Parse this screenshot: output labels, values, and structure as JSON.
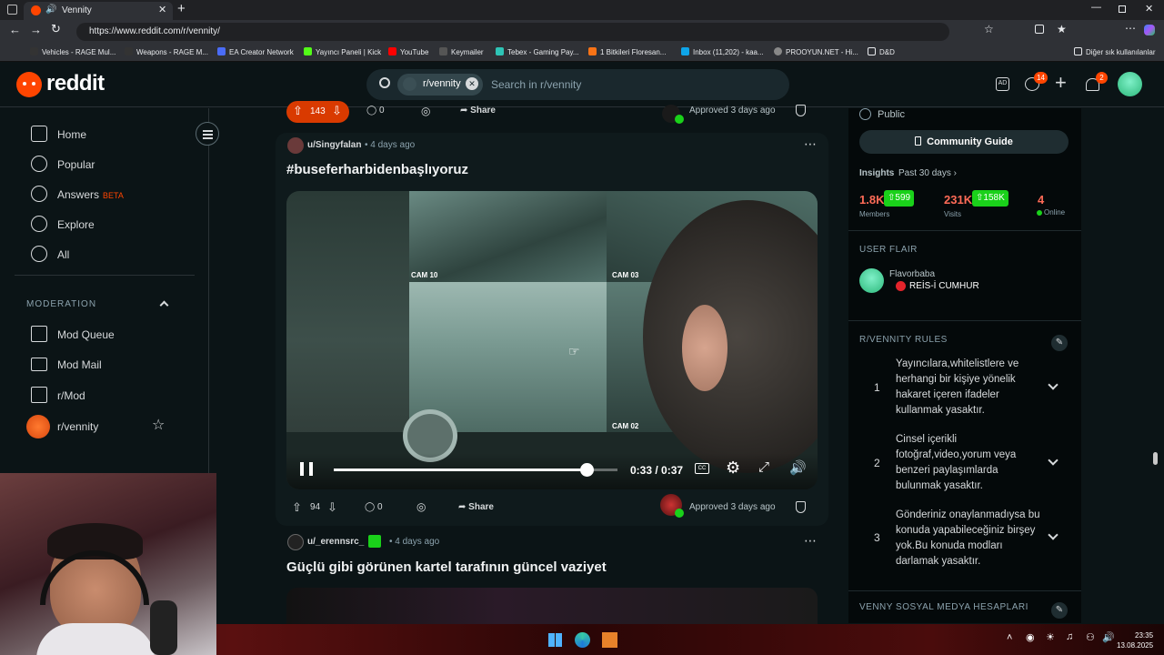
{
  "browser": {
    "tab_title": "Vennity",
    "url": "https://www.reddit.com/r/vennity/",
    "bookmarks": [
      "Vehicles - RAGE Mul...",
      "Weapons - RAGE M...",
      "EA Creator Network",
      "Yayıncı Paneli | Kick",
      "YouTube",
      "Keymailer",
      "Tebex - Gaming Pay...",
      "1 Bitkileri Floresan...",
      "Inbox (11,202) - kaa...",
      "PROOYUN.NET - Hi...",
      "D&D"
    ],
    "other_bookmarks": "Diğer sık kullanılanlar"
  },
  "header": {
    "logo": "reddit",
    "search_chip": "r/vennity",
    "search_placeholder": "Search in r/vennity",
    "chat_badge": "14",
    "notif_badge": "2"
  },
  "leftnav": {
    "items": [
      {
        "label": "Home",
        "icon": "home-icon"
      },
      {
        "label": "Popular",
        "icon": "popular-icon"
      },
      {
        "label": "Answers",
        "icon": "answers-icon",
        "badge": "BETA"
      },
      {
        "label": "Explore",
        "icon": "explore-icon"
      },
      {
        "label": "All",
        "icon": "all-icon"
      }
    ],
    "moderation_title": "MODERATION",
    "mod_items": [
      {
        "label": "Mod Queue",
        "icon": "mod-queue-icon"
      },
      {
        "label": "Mod Mail",
        "icon": "mod-mail-icon"
      },
      {
        "label": "r/Mod",
        "icon": "mod-icon"
      },
      {
        "label": "r/vennity",
        "icon": "vennity-icon"
      }
    ]
  },
  "posts": {
    "prev": {
      "votes": "143",
      "comments": "0",
      "share": "Share",
      "approved": "Approved 3 days ago"
    },
    "video_post": {
      "author": "u/Singyfalan",
      "time": "4 days ago",
      "title": "#buseferharbidenbaşlıyoruz",
      "cams": [
        "CAM 10",
        "CAM 03",
        "CAM 02"
      ],
      "time_display": "0:33 / 0:37",
      "progress": 0.89,
      "votes": "94",
      "comments": "0",
      "share": "Share",
      "approved": "Approved 3 days ago"
    },
    "next": {
      "author": "u/_erennsrc_",
      "time": "4 days ago",
      "title": "Güçlü gibi görünen kartel tarafının güncel vaziyet"
    }
  },
  "sidebar": {
    "visibility": "Public",
    "guide_button": "Community Guide",
    "insights_label": "Insights",
    "insights_period": "Past 30 days",
    "stats": [
      {
        "value": "1.8K",
        "delta": "599",
        "label": "Members"
      },
      {
        "value": "231K",
        "delta": "158K",
        "label": "Visits"
      },
      {
        "value": "4",
        "label": "Online"
      }
    ],
    "user_flair_title": "USER FLAIR",
    "flair_user": "Flavorbaba",
    "flair_text": "REİS-İ CUMHUR",
    "rules_title": "R/VENNITY RULES",
    "rules": [
      {
        "num": "1",
        "text": "Yayıncılara,whitelistlere ve herhangi bir kişiye yönelik hakaret içeren ifadeler kullanmak yasaktır."
      },
      {
        "num": "2",
        "text": "Cinsel içerikli fotoğraf,video,yorum veya benzeri paylaşımlarda bulunmak yasaktır."
      },
      {
        "num": "3",
        "text": "Gönderiniz onaylanmadıysa bu konuda yapabileceğiniz birşey yok.Bu konuda modları darlamak yasaktır."
      }
    ],
    "social_title": "VENNY SOSYAL MEDYA HESAPLARI"
  },
  "taskbar": {
    "time": "23:35",
    "date": "13.08.2025"
  },
  "colors": {
    "accent": "#ff4500",
    "green": "#1ad11a",
    "bg": "#0b1416"
  }
}
